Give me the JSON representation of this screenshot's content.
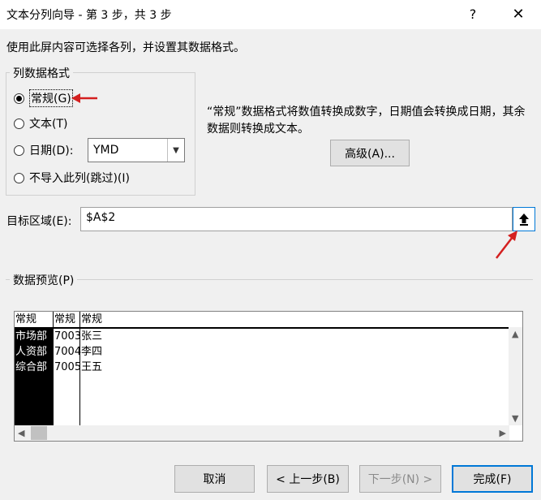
{
  "window": {
    "title": "文本分列向导 - 第 3 步，共 3 步",
    "help": "?",
    "close": "✕"
  },
  "intro": "使用此屏内容可选择各列，并设置其数据格式。",
  "format_group": {
    "legend": "列数据格式",
    "options": [
      {
        "label": "常规(G)",
        "checked": true
      },
      {
        "label": "文本(T)",
        "checked": false
      },
      {
        "label": "日期(D):",
        "checked": false
      },
      {
        "label": "不导入此列(跳过)(I)",
        "checked": false
      }
    ],
    "date_format": "YMD"
  },
  "description": "“常规”数据格式将数值转换成数字，日期值会转换成日期，其余数据则转换成文本。",
  "advanced_button": "高级(A)...",
  "target": {
    "label": "目标区域(E):",
    "value": "$A$2"
  },
  "preview": {
    "legend": "数据预览(P)",
    "columns": [
      {
        "header": "常规",
        "cells": [
          "市场部",
          "人资部",
          "综合部"
        ],
        "selected": true
      },
      {
        "header": "常规",
        "cells": [
          "7003",
          "7004",
          "7005"
        ],
        "selected": false
      },
      {
        "header": "常规",
        "cells": [
          "张三",
          "李四",
          "王五"
        ],
        "selected": false
      }
    ]
  },
  "buttons": {
    "cancel": "取消",
    "back": "< 上一步(B)",
    "next": "下一步(N) >",
    "finish": "完成(F)"
  },
  "colors": {
    "annotation_arrow": "#d42020",
    "focus_border": "#0078d7"
  }
}
